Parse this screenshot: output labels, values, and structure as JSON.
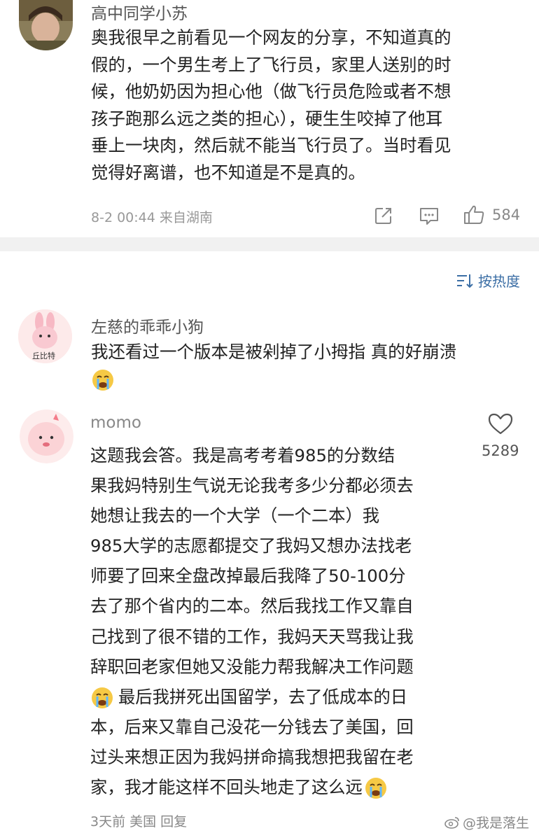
{
  "top_comment": {
    "username": "高中同学小苏",
    "lines": [
      "奥我很早之前看见一个网友的分享，不知道真的",
      "假的，一个男生考上了飞行员，家里人送别的时",
      "候，他奶奶因为担心他（做飞行员危险或者不想",
      "孩子跑那么远之类的担心），硬生生咬掉了他耳",
      "垂上一块肉，然后就不能当飞行员了。当时看见",
      "觉得好离谱，也不知道是不是真的。"
    ],
    "meta": "8-2 00:44  来自湖南",
    "like_count": "584"
  },
  "sort_label": "按热度",
  "comments": [
    {
      "username": "左慈的乖乖小狗",
      "avatar_text": "丘比特",
      "lines": [
        "我还看过一个版本是被剁掉了小拇指 真的好崩溃"
      ]
    },
    {
      "username": "momo",
      "like_count": "5289",
      "lines": [
        "这题我会答。我是高考考着985的分数结",
        "果我妈特别生气说无论我考多少分都必须去",
        "她想让我去的一个大学（一个二本）我",
        "985大学的志愿都提交了我妈又想办法找老",
        "师要了回来全盘改掉最后我降了50-100分",
        "去了那个省内的二本。然后我找工作又靠自",
        "己找到了很不错的工作，我妈天天骂我让我",
        "辞职回老家但她又没能力帮我解决工作问题",
        "最后我拼死出国留学，去了低成本的日",
        "本，后来又靠自己没花一分钱去了美国，回",
        "过头来想正因为我妈拼命搞我想把我留在老",
        "家，我才能这样不回头地走了这么远"
      ],
      "meta": "3天前  美国  回复"
    }
  ],
  "watermark": "@我是落生",
  "colors": {
    "link_blue": "#3b6ea5",
    "divider": "#f1f1f1",
    "meta_gray": "#999999"
  }
}
